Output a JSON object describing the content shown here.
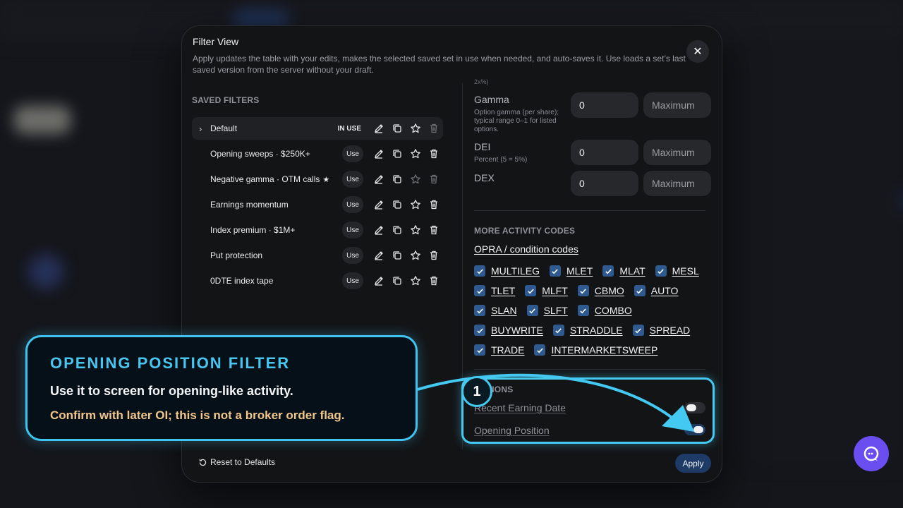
{
  "modal": {
    "title": "Filter View",
    "description": "Apply updates the table with your edits, makes the selected saved set in use when needed, and auto-saves it. Use loads a set’s last saved version from the server without your draft.",
    "close_icon": "close-icon"
  },
  "saved_filters": {
    "heading": "SAVED FILTERS",
    "in_use_label": "IN USE",
    "use_label": "Use",
    "items": [
      {
        "name": "Default",
        "active": true,
        "favorite": true
      },
      {
        "name": "Opening sweeps · $250K+",
        "active": false,
        "favorite": false
      },
      {
        "name": "Negative gamma · OTM calls",
        "active": false,
        "favorite": true
      },
      {
        "name": "Earnings momentum",
        "active": false,
        "favorite": false
      },
      {
        "name": "Index premium · $1M+",
        "active": false,
        "favorite": false
      },
      {
        "name": "Put protection",
        "active": false,
        "favorite": false
      },
      {
        "name": "0DTE index tape",
        "active": false,
        "favorite": false
      }
    ]
  },
  "greeks": {
    "cut_text": "2x%)",
    "gamma": {
      "label": "Gamma",
      "sub": "Option gamma (per share); typical range 0–1 for listed options.",
      "min": "0",
      "max_placeholder": "Maximum"
    },
    "dei": {
      "label": "DEI",
      "sub": "Percent (5 = 5%)",
      "min": "0",
      "max_placeholder": "Maximum"
    },
    "dex": {
      "label": "DEX",
      "min": "0",
      "max_placeholder": "Maximum"
    }
  },
  "activity": {
    "heading": "MORE ACTIVITY CODES",
    "link": "OPRA / condition codes",
    "rows": [
      [
        "MULTILEG",
        "MLET",
        "MLAT",
        "MESL"
      ],
      [
        "TLET",
        "MLFT",
        "CBMO",
        "AUTO"
      ],
      [
        "SLAN",
        "SLFT",
        "COMBO"
      ],
      [
        "BUYWRITE",
        "STRADDLE",
        "SPREAD"
      ],
      [
        "TRADE",
        "INTERMARKETSWEEP"
      ]
    ]
  },
  "options": {
    "heading": "OPTIONS",
    "recent_earning": {
      "label": "Recent Earning Date",
      "on": false
    },
    "opening_position": {
      "label": "Opening Position",
      "on": true
    }
  },
  "footer": {
    "reset_label": "Reset to Defaults",
    "apply_label": "Apply"
  },
  "callout": {
    "step": "1",
    "title": "OPENING POSITION FILTER",
    "body": "Use it to screen for opening-like activity.",
    "note": "Confirm with later OI; this is not a broker order flag."
  },
  "colors": {
    "accent": "#44c9f2",
    "note": "#f3c78a",
    "chat": "#6b4ef0"
  }
}
